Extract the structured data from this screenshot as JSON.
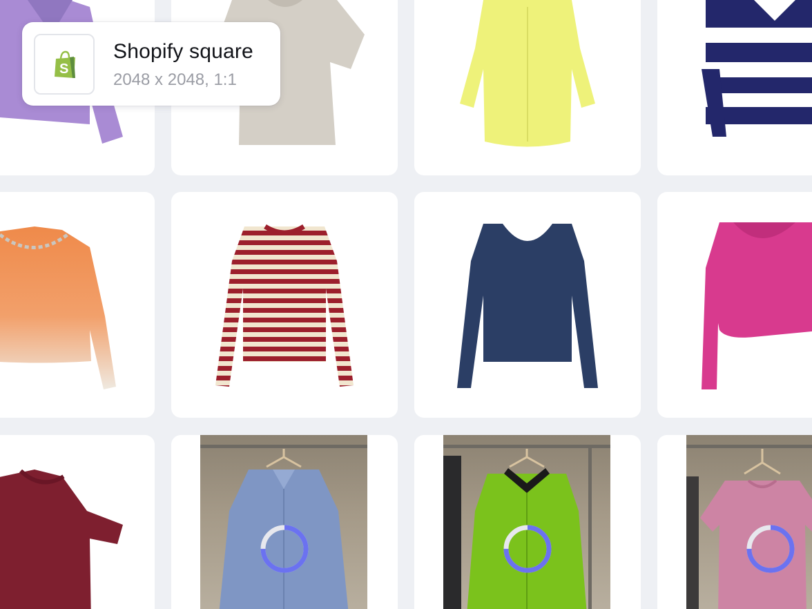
{
  "tooltip": {
    "title": "Shopify square",
    "subtitle": "2048 x 2048, 1:1",
    "icon": "shopify-bag-icon",
    "brand_color": "#95bf47"
  },
  "grid": {
    "items": [
      {
        "name": "purple knit sweater",
        "color": "#a98bd4",
        "status": "done"
      },
      {
        "name": "beige oversized t-shirt",
        "color": "#cbc6bd",
        "status": "done"
      },
      {
        "name": "yellow button-up shirt",
        "color": "#eef27a",
        "status": "done"
      },
      {
        "name": "navy and white striped rugby shirt",
        "color": "#23276b",
        "status": "done"
      },
      {
        "name": "orange ombre sweater with chain",
        "color": "#ef8a4a",
        "status": "done"
      },
      {
        "name": "red and cream striped long sleeve top",
        "color": "#9c1f2c",
        "status": "done"
      },
      {
        "name": "navy scoop neck long sleeve top",
        "color": "#2b3e65",
        "status": "done"
      },
      {
        "name": "pink cropped hoodie",
        "color": "#d83a8e",
        "status": "done"
      },
      {
        "name": "burgundy t-shirt",
        "color": "#7e1f2f",
        "status": "done"
      },
      {
        "name": "blue striped shirt on hanger",
        "color": "#7f96c4",
        "status": "processing"
      },
      {
        "name": "green cardigan on hanger",
        "color": "#7bc21c",
        "status": "processing"
      },
      {
        "name": "pink t-shirt on hanger",
        "color": "#cd84a4",
        "status": "processing"
      }
    ]
  },
  "spinner_colors": {
    "track": "#e7e8ee",
    "progress": "#6b72f0"
  }
}
